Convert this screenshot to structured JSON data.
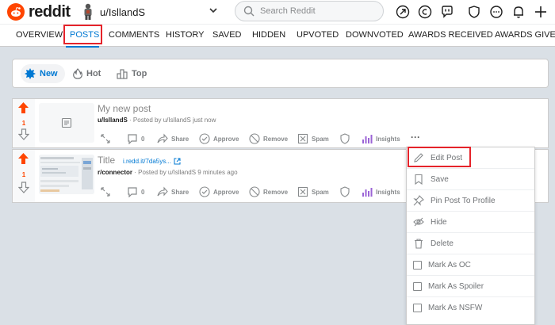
{
  "header": {
    "logo_text": "reddit",
    "username": "u/IsllandS",
    "search_placeholder": "Search Reddit"
  },
  "tabs": [
    "OVERVIEW",
    "POSTS",
    "COMMENTS",
    "HISTORY",
    "SAVED",
    "HIDDEN",
    "UPVOTED",
    "DOWNVOTED",
    "AWARDS RECEIVED",
    "AWARDS GIVEN"
  ],
  "active_tab": "POSTS",
  "sort": [
    "New",
    "Hot",
    "Top"
  ],
  "active_sort": "New",
  "posts": [
    {
      "title": "My new post",
      "subreddit": "u/IsllandS",
      "meta": " · Posted by u/IsllandS just now",
      "score": "1",
      "comments": "0"
    },
    {
      "title": "Title",
      "link": "i.redd.it/7da5ys...",
      "subreddit": "r/connector",
      "meta": " · Posted by u/IsllandS 9 minutes ago",
      "score": "1",
      "comments": "0"
    }
  ],
  "actions": {
    "share": "Share",
    "approve": "Approve",
    "remove": "Remove",
    "spam": "Spam",
    "insights": "Insights",
    "more": "···"
  },
  "menu": [
    "Edit Post",
    "Save",
    "Pin Post To Profile",
    "Hide",
    "Delete",
    "Mark As OC",
    "Mark As Spoiler",
    "Mark As NSFW"
  ],
  "colors": {
    "accent": "#0079d3",
    "brand": "#ff4500",
    "highlight": "#e5232a"
  }
}
